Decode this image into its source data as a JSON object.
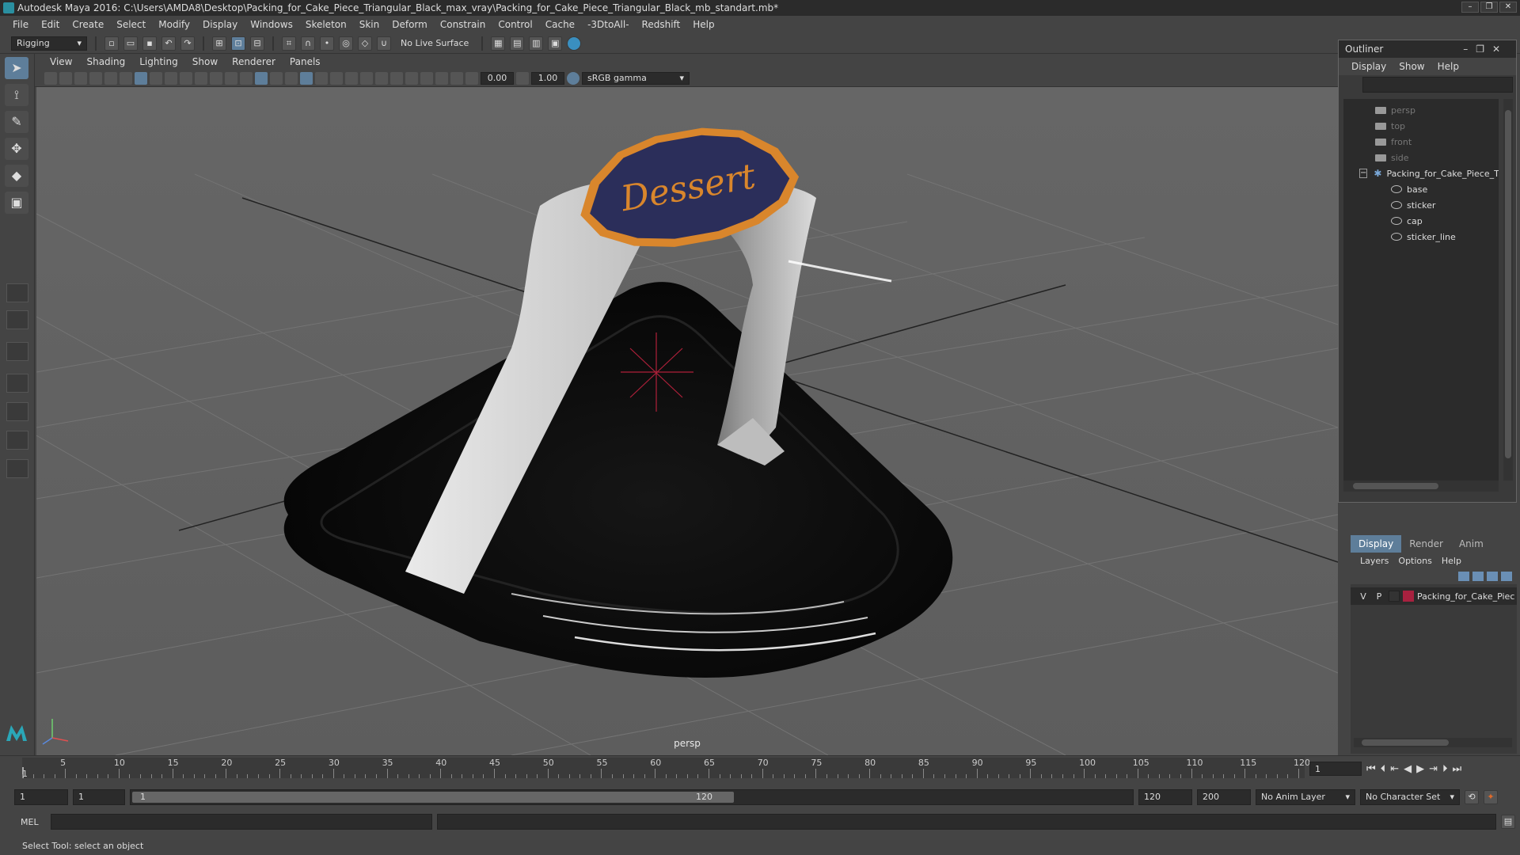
{
  "window": {
    "title": "Autodesk Maya 2016: C:\\Users\\AMDA8\\Desktop\\Packing_for_Cake_Piece_Triangular_Black_max_vray\\Packing_for_Cake_Piece_Triangular_Black_mb_standart.mb*",
    "controls": [
      "–",
      "❐",
      "✕"
    ]
  },
  "menubar": [
    "File",
    "Edit",
    "Create",
    "Select",
    "Modify",
    "Display",
    "Windows",
    "Skeleton",
    "Skin",
    "Deform",
    "Constrain",
    "Control",
    "Cache",
    "-3DtoAll-",
    "Redshift",
    "Help"
  ],
  "statusline": {
    "mode": "Rigging",
    "live_surface": "No Live Surface"
  },
  "viewport": {
    "menu": [
      "View",
      "Shading",
      "Lighting",
      "Show",
      "Renderer",
      "Panels"
    ],
    "exposure": "0.00",
    "gamma": "1.00",
    "color_space": "sRGB gamma",
    "camera_label": "persp",
    "sticker_text": "Dessert"
  },
  "outliner": {
    "title": "Outliner",
    "menu": [
      "Display",
      "Show",
      "Help"
    ],
    "items": [
      {
        "label": "persp",
        "type": "camera"
      },
      {
        "label": "top",
        "type": "camera"
      },
      {
        "label": "front",
        "type": "camera"
      },
      {
        "label": "side",
        "type": "camera"
      },
      {
        "label": "Packing_for_Cake_Piece_Tr",
        "type": "group"
      },
      {
        "label": "base",
        "type": "mesh"
      },
      {
        "label": "sticker",
        "type": "mesh"
      },
      {
        "label": "cap",
        "type": "mesh"
      },
      {
        "label": "sticker_line",
        "type": "mesh"
      }
    ]
  },
  "layer_editor": {
    "tabs": [
      "Display",
      "Render",
      "Anim"
    ],
    "menu": [
      "Layers",
      "Options",
      "Help"
    ],
    "layer": {
      "v": "V",
      "p": "P",
      "name": "Packing_for_Cake_Piec",
      "color": "#a8213f"
    }
  },
  "timeline": {
    "ticks": [
      "5",
      "10",
      "15",
      "20",
      "25",
      "30",
      "35",
      "40",
      "45",
      "50",
      "55",
      "60",
      "65",
      "70",
      "75",
      "80",
      "85",
      "90",
      "95",
      "100",
      "105",
      "110",
      "115",
      "120"
    ],
    "current_frame_marker": "1",
    "current_frame": "1"
  },
  "range": {
    "start": "1",
    "playback_start": "1",
    "slider_start": "1",
    "slider_end": "120",
    "playback_end": "120",
    "end": "200",
    "anim_layer": "No Anim Layer",
    "char_set": "No Character Set"
  },
  "cmdline": {
    "label": "MEL"
  },
  "helpline": {
    "text": "Select Tool: select an object"
  }
}
